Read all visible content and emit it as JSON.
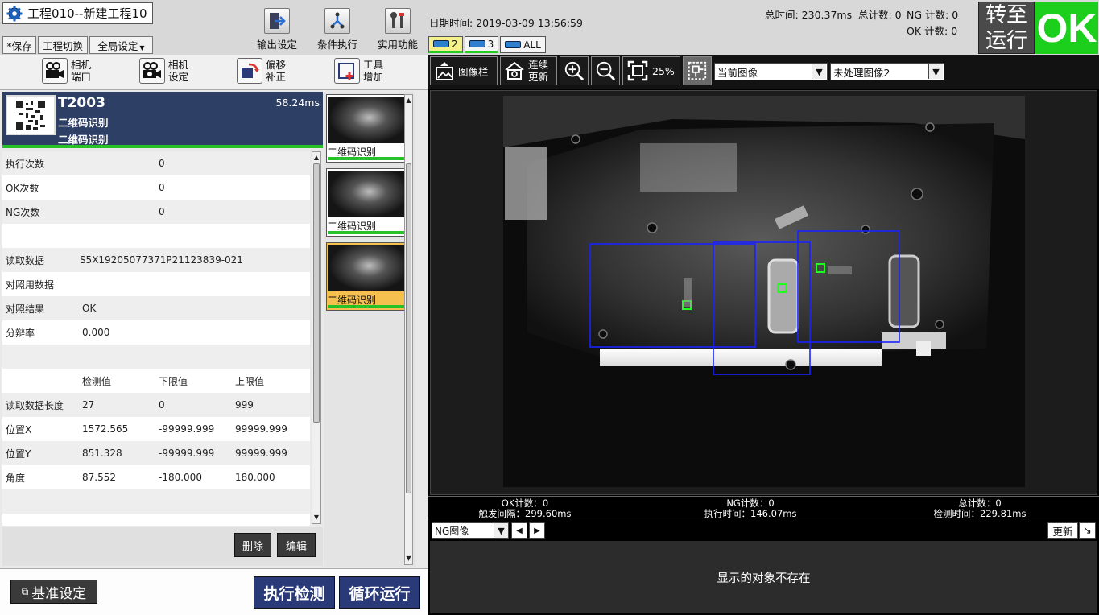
{
  "project": {
    "title": "工程010--新建工程10"
  },
  "menu": {
    "save": "*保存",
    "switch_project": "工程切换",
    "global_settings": "全局设定"
  },
  "top_tools": {
    "output_settings": "输出设定",
    "condition_exec": "条件执行",
    "utilities": "实用功能"
  },
  "datetime": "日期时间: 2019-03-09 13:56:59",
  "cam_tabs": {
    "tab2": "2",
    "tab3": "3",
    "all": "ALL"
  },
  "stats": {
    "total_time": "总时间: 230.37ms",
    "total_count": "总计数: 0",
    "ng_count": "NG 计数: 0",
    "ok_count": "OK 计数: 0"
  },
  "run": {
    "goto_line1": "转至",
    "goto_line2": "运行",
    "ok": "OK"
  },
  "left_toolbar": {
    "camera_port_1": "相机",
    "camera_port_2": "端口",
    "camera_settings_1": "相机",
    "camera_settings_2": "设定",
    "offset_1": "偏移",
    "offset_2": "补正",
    "tool_add_1": "工具",
    "tool_add_2": "增加"
  },
  "item": {
    "name": "T2003",
    "time": "58.24ms",
    "sub1": "二维码识别",
    "sub2": "二维码识别"
  },
  "table": {
    "rows": [
      [
        "执行次数",
        "",
        "0",
        ""
      ],
      [
        "OK次数",
        "",
        "0",
        ""
      ],
      [
        "NG次数",
        "",
        "0",
        ""
      ],
      [
        "",
        "",
        "",
        ""
      ],
      [
        "读取数据",
        "S5X19205077371P21123839-021",
        "",
        ""
      ],
      [
        "对照用数据",
        "",
        "",
        ""
      ],
      [
        "对照结果",
        "OK",
        "",
        ""
      ],
      [
        "分辩率",
        "0.000",
        "",
        ""
      ],
      [
        "",
        "",
        "",
        ""
      ],
      [
        "",
        "检测值",
        "下限值",
        "上限值"
      ],
      [
        "读取数据长度",
        "27",
        "0",
        "999"
      ],
      [
        "位置X",
        "1572.565",
        "-99999.999",
        "99999.999"
      ],
      [
        "位置Y",
        "851.328",
        "-99999.999",
        "99999.999"
      ],
      [
        "角度",
        "87.552",
        "-180.000",
        "180.000"
      ],
      [
        "",
        "",
        "",
        ""
      ]
    ]
  },
  "actions": {
    "delete": "删除",
    "edit": "编辑"
  },
  "thumbs": [
    "二维码识别",
    "二维码识别",
    "二维码识别"
  ],
  "bottom_left": {
    "baseline": "基准设定",
    "execute": "执行检测",
    "loop": "循环运行"
  },
  "img_toolbar": {
    "image_bar": "图像栏",
    "continuous_1": "连续",
    "continuous_2": "更新",
    "zoom": "25%",
    "current_image": "当前图像",
    "unprocessed": "未处理图像2"
  },
  "stats_bar": {
    "ok": "OK计数：0",
    "trigger": "触发间隔：299.60ms",
    "ng": "NG计数：0",
    "exec": "执行时间：146.07ms",
    "total": "总计数：0",
    "detect": "检测时间：229.81ms"
  },
  "ng_bar": {
    "select": "NG图像",
    "update": "更新"
  },
  "ng_message": "显示的对象不存在",
  "colors": {
    "ok_green": "#1ccf1c",
    "item_blue": "#2e3f66",
    "button_blue": "#2a3a78",
    "roi_blue": "#1a22ff",
    "mark_green": "#20ff20"
  }
}
